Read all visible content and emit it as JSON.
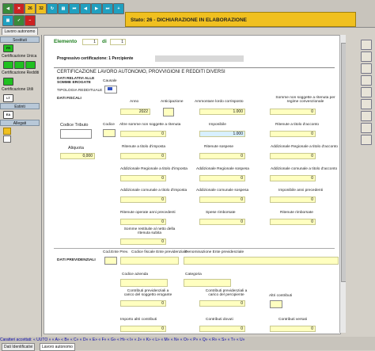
{
  "status": "Stato: 26 - DICHIARAZIONE IN ELABORAZIONE",
  "toolbar": {
    "codes": [
      "26",
      "32"
    ]
  },
  "left_tab": "Lavoro autonomo",
  "left": {
    "sostituti": "Sostituti",
    "cert_unica": "Certificazione Unica",
    "cert_redditi": "Certificazione Redditi",
    "cert_utili": "Certificazione Utili",
    "estinti": "Estinti",
    "allegati": "Allegati",
    "btn_fr": "FR",
    "btn_lt": "LT",
    "btn_ea": "EA"
  },
  "form": {
    "elemento_label": "Elemento",
    "elemento_val": "1",
    "di_label": "di",
    "di_val": "1",
    "progressivo": "Progressivo certificazione: 1 Percipiente",
    "cert_title": "CERTIFICAZIONE LAVORO AUTONOMO, PROVVIGIONI E REDDITI DIVERSI",
    "dati_relativi": "DATI RELATIVI ALLE SOMME EROGATE",
    "tipologia": "TIPOLOGIA REDDITUALE",
    "causale": "Causale",
    "dati_fiscali": "DATI FISCALI",
    "anno": "Anno",
    "anno_val": "2022",
    "anticipazione": "Anticipazione",
    "ammontare": "Ammontare lordo corrisposto",
    "ammontare_val": "1.000",
    "somme_non_sogg": "Somme non soggette a ritenuta per regime convenzionale",
    "codice_tributo": "Codice Tributo",
    "codice": "Codice",
    "altre_somme": "Altre somme non soggette a ritenuta",
    "imponibile": "Imponibile",
    "imponibile_val": "1.000",
    "ritenute_acconto": "Ritenute a titolo d'acconto",
    "aliquota": "Aliquota",
    "aliquota_val": "0,000",
    "ritenute_imposta": "Ritenute a titolo d'imposta",
    "ritenute_sospese": "Ritenute sospese",
    "add_reg_acconto": "Addizionale Regionale a titolo d'acconto",
    "add_reg_imposta": "Addizionale Regionale a titolo d'imposta",
    "add_reg_sospesa": "Addizionale Regionale sospesa",
    "add_com_acconto": "Addizionale comunale a titolo d'acconto",
    "add_com_imposta": "Addizionale comunale a titolo d'imposta",
    "add_com_sospesa": "Addizionale comunale sospesa",
    "imponibile_anni_prec": "Imponibile anni precedenti",
    "ritenute_anni_prec": "Ritenute operate anni precedenti",
    "spese_rimborsate": "Spese rimborsate",
    "ritenute_rimborsate": "Ritenute rimborsate",
    "somme_restituite": "Somme restituite al netto della ritenuta subita",
    "dati_previdenziali": "DATI PREVIDENZIALI",
    "cod_ente_prev": "Cod.Ente Prev.",
    "cf_ente": "Codice fiscale Ente previdenziale",
    "denominazione": "Denominazione Ente previdenziale",
    "codice_azienda": "Codice azienda",
    "categoria": "Categoria",
    "contributi_sogg": "Contributi previdenziali a carico del soggetto erogante",
    "contributi_perc": "Contributi previdenziali a carico del percipiente",
    "altri_contributi": "Altri contributi",
    "importo_altri": "Importo altri contributi",
    "contributi_dovuti": "Contributi dovuti",
    "contributi_versati": "Contributi versati",
    "zero": "0"
  },
  "chars": "Caratteri accettati:  « UUTO »  « A»  « B»  « C»  « D»  « E»  « F»  « G»  « H»  « I»  « J»  « K»  « L»  « M»  « N»  « O»  « P»  « Q»  « R»  « S»  « T»  « U»",
  "bottom_tabs": [
    "Dati Identificativi",
    "Lavoro autonomo"
  ]
}
